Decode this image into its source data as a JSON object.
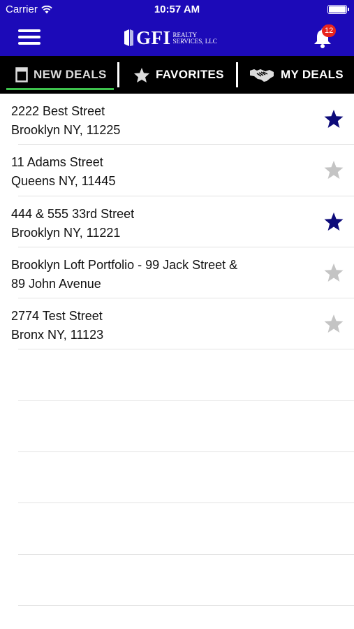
{
  "status_bar": {
    "carrier": "Carrier",
    "time": "10:57 AM"
  },
  "header": {
    "logo_main": "GFI",
    "logo_sub_line1": "REALTY",
    "logo_sub_line2": "SERVICES, LLC",
    "notification_count": "12",
    "accent_color": "#1c0ab8"
  },
  "tabs": [
    {
      "label": "NEW DEALS",
      "icon": "document-icon",
      "active": true
    },
    {
      "label": "FAVORITES",
      "icon": "star-icon",
      "active": false
    },
    {
      "label": "MY DEALS",
      "icon": "handshake-icon",
      "active": false
    }
  ],
  "deals": [
    {
      "line1": "2222 Best Street",
      "line2": "Brooklyn NY, 11225",
      "favorite": true
    },
    {
      "line1": "11 Adams Street",
      "line2": "Queens NY, 11445",
      "favorite": false
    },
    {
      "line1": "444 & 555 33rd Street",
      "line2": "Brooklyn NY, 11221",
      "favorite": true
    },
    {
      "line1": "Brooklyn Loft Portfolio - 99 Jack Street &",
      "line2": "89 John Avenue",
      "favorite": false
    },
    {
      "line1": "2774 Test Street",
      "line2": "Bronx NY, 11123",
      "favorite": false
    }
  ],
  "colors": {
    "favorite_star": "#0d0b7a",
    "unfavorite_star": "#c4c4c4",
    "active_tab_underline": "#3dc14c",
    "badge": "#e8241d"
  }
}
